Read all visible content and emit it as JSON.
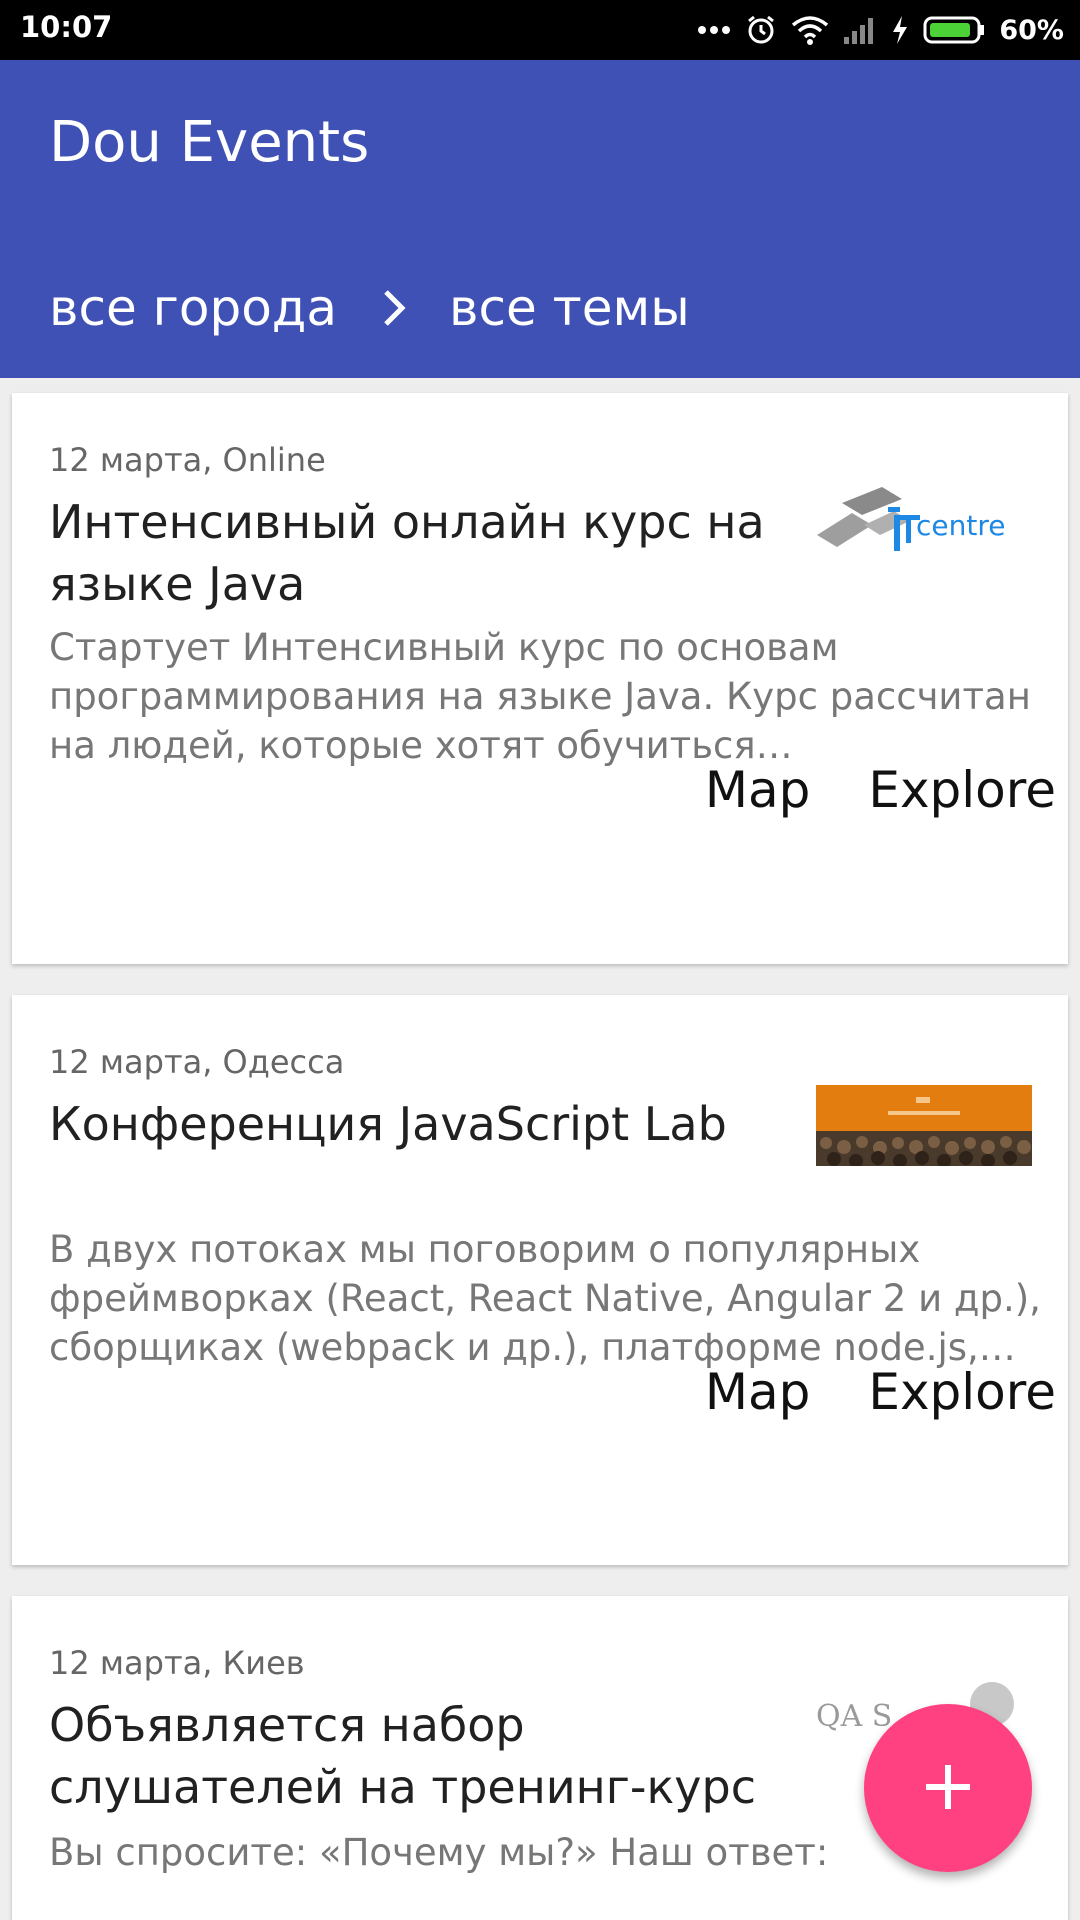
{
  "status_bar": {
    "time": "10:07",
    "battery_percent": "60%",
    "icons": [
      "more-dots-icon",
      "alarm-icon",
      "wifi-icon",
      "signal-icon",
      "charging-bolt-icon",
      "battery-icon"
    ]
  },
  "app_bar": {
    "title": "Dou Events",
    "filter_city": "все города",
    "filter_topic": "все темы",
    "color": "#3f51b5"
  },
  "events": [
    {
      "meta": "12 марта, Online",
      "title": "Интенсивный онлайн курс на языке Java",
      "description": "Стартует Интенсивный курс по основам программирования на языке Java. Курс рассчитан на людей, которые хотят обучиться…",
      "logo_text": "centre",
      "map_label": "Map",
      "explore_label": "Explore"
    },
    {
      "meta": "12 марта, Одесса",
      "title": "Конференция JavaScript Lab",
      "description": "В двух потоках мы поговорим о популярных фреймворках (React, React Native, Angular 2 и др.), сборщиках (webpack и др.), платформе node.js,…",
      "map_label": "Map",
      "explore_label": "Explore"
    },
    {
      "meta": "12 марта, Киев",
      "title": "Объявляется набор слушателей на тренинг-курс",
      "description": "Вы спросите: «Почему мы?» Наш ответ:"
    }
  ],
  "fab": {
    "icon": "plus-icon",
    "color": "#ff4081"
  }
}
